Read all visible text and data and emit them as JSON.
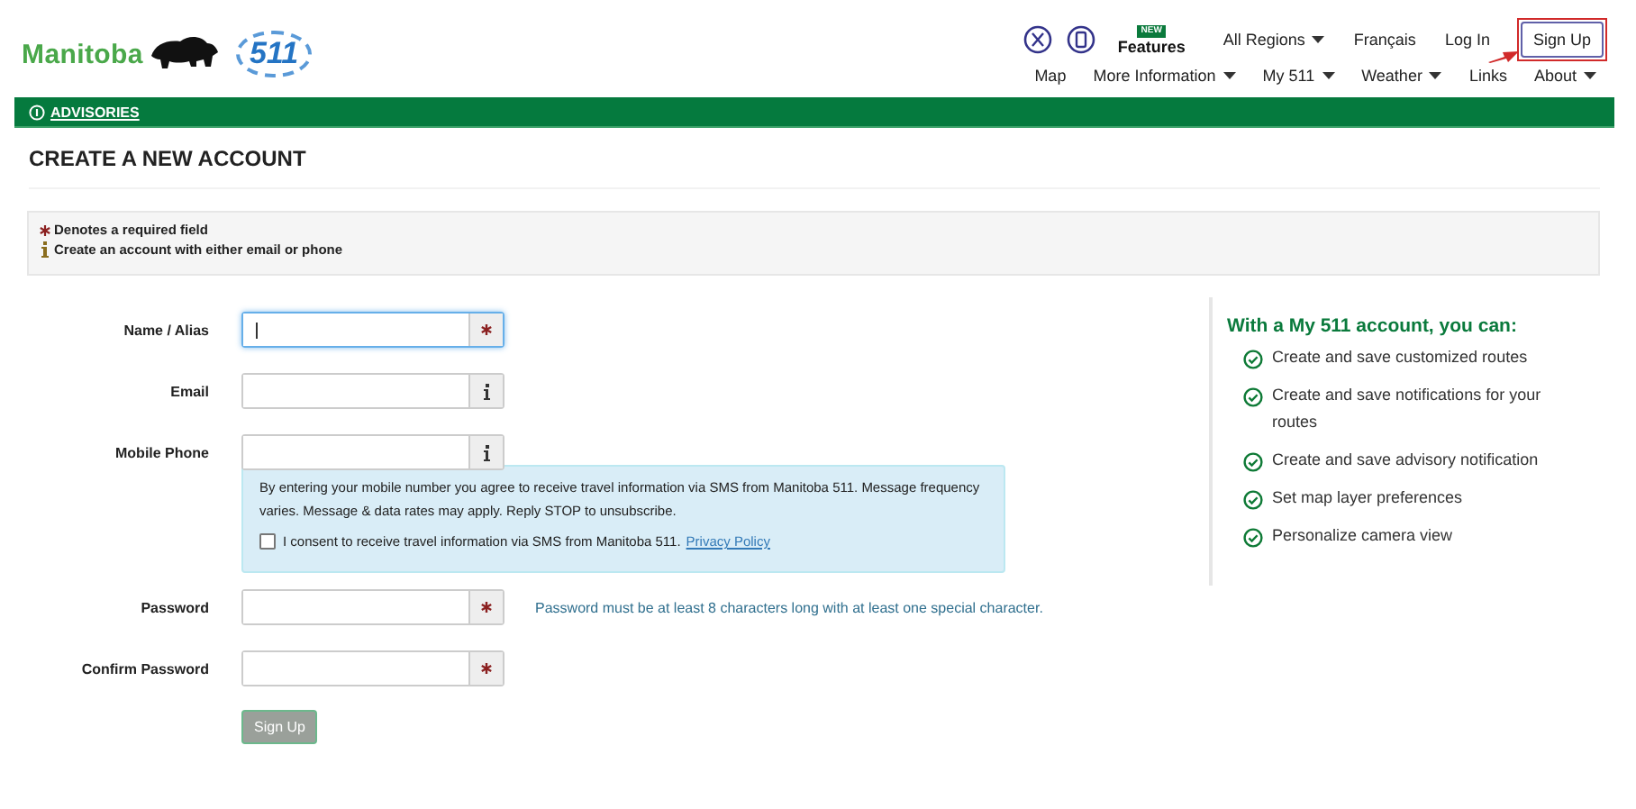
{
  "logo": {
    "wordmark": "Manitoba",
    "badge": "511"
  },
  "top_nav": [
    {
      "kind": "social"
    },
    {
      "kind": "app"
    },
    {
      "kind": "feature",
      "label": "Features",
      "badge": "NEW"
    },
    {
      "kind": "dropdown",
      "label": "All Regions"
    },
    {
      "kind": "link",
      "label": "Français"
    },
    {
      "kind": "link",
      "label": "Log In"
    },
    {
      "kind": "button",
      "label": "Sign Up",
      "highlighted": true
    }
  ],
  "main_nav": [
    {
      "label": "Map",
      "dropdown": false
    },
    {
      "label": "More Information",
      "dropdown": true
    },
    {
      "label": "My 511",
      "dropdown": true
    },
    {
      "label": "Weather",
      "dropdown": true
    },
    {
      "label": "Links",
      "dropdown": false
    },
    {
      "label": "About",
      "dropdown": true
    }
  ],
  "advisories": {
    "label": "ADVISORIES"
  },
  "page_title": "CREATE A NEW ACCOUNT",
  "notice": [
    {
      "kind": "required",
      "text": "Denotes a required field"
    },
    {
      "kind": "info",
      "text": "Create an account with either email or phone"
    }
  ],
  "fields": [
    {
      "label": "Name / Alias",
      "required": true,
      "focused": true
    },
    {
      "label": "Email",
      "required": false,
      "focused": false
    },
    {
      "label": "Mobile Phone",
      "required": false,
      "focused": false,
      "sms": {
        "text": "By entering your mobile number you agree to receive travel information via SMS from Manitoba 511. Message frequency varies. Message & data rates may apply. Reply STOP to unsubscribe.",
        "consent": "I consent to receive travel information via SMS from Manitoba 511.",
        "checked": false,
        "link": "Privacy Policy"
      }
    },
    {
      "label": "Password",
      "required": true,
      "focused": false,
      "hint": "Password must be at least 8 characters long with at least one special character."
    },
    {
      "label": "Confirm Password",
      "required": true,
      "focused": false
    }
  ],
  "submit": {
    "label": "Sign Up",
    "disabled": true
  },
  "benefits": {
    "title": "With a My 511 account, you can:",
    "items": [
      "Create and save customized routes",
      "Create and save notifications for your routes",
      "Create and save advisory notification",
      "Set map layer preferences",
      "Personalize camera view"
    ]
  }
}
